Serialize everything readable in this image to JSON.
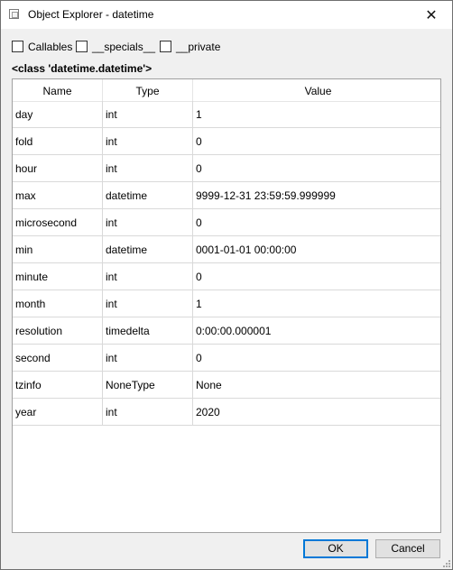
{
  "window": {
    "title": "Object Explorer - datetime",
    "close_glyph": "✕"
  },
  "options": [
    {
      "label": "Callables",
      "checked": false
    },
    {
      "label": "__specials__",
      "checked": false
    },
    {
      "label": "__private",
      "checked": false
    }
  ],
  "class_label": "<class 'datetime.datetime'>",
  "table": {
    "headers": [
      "Name",
      "Type",
      "Value"
    ],
    "rows": [
      {
        "name": "day",
        "type": "int",
        "value": "1"
      },
      {
        "name": "fold",
        "type": "int",
        "value": "0"
      },
      {
        "name": "hour",
        "type": "int",
        "value": "0"
      },
      {
        "name": "max",
        "type": "datetime",
        "value": "9999-12-31 23:59:59.999999"
      },
      {
        "name": "microsecond",
        "type": "int",
        "value": "0"
      },
      {
        "name": "min",
        "type": "datetime",
        "value": "0001-01-01 00:00:00"
      },
      {
        "name": "minute",
        "type": "int",
        "value": "0"
      },
      {
        "name": "month",
        "type": "int",
        "value": "1"
      },
      {
        "name": "resolution",
        "type": "timedelta",
        "value": "0:00:00.000001"
      },
      {
        "name": "second",
        "type": "int",
        "value": "0"
      },
      {
        "name": "tzinfo",
        "type": "NoneType",
        "value": "None"
      },
      {
        "name": "year",
        "type": "int",
        "value": "2020"
      }
    ]
  },
  "buttons": {
    "ok": "OK",
    "cancel": "Cancel"
  },
  "icons": {
    "app": "app-window-icon",
    "close": "close-icon",
    "grip": "resize-grip-icon"
  },
  "colors": {
    "focus_border": "#0078d7",
    "dialog_bg": "#f0f0f0",
    "button_bg": "#e1e1e1"
  }
}
